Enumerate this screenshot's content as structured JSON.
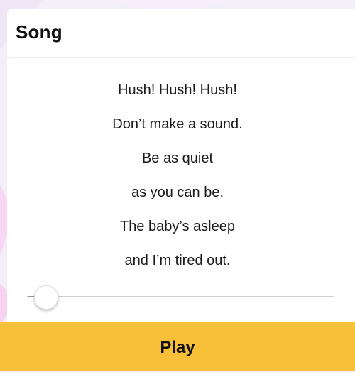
{
  "card": {
    "title": "Song"
  },
  "lyrics": {
    "lines": [
      "Hush! Hush! Hush!",
      "Don’t make a sound.",
      "Be as quiet",
      "as you can be.",
      "The baby’s asleep",
      "and I’m tired out."
    ]
  },
  "slider": {
    "value_fraction": 0.0
  },
  "play": {
    "label": "Play"
  },
  "colors": {
    "background": "#f3eff8",
    "card": "#ffffff",
    "play_button": "#f7c038",
    "text": "#111111"
  }
}
